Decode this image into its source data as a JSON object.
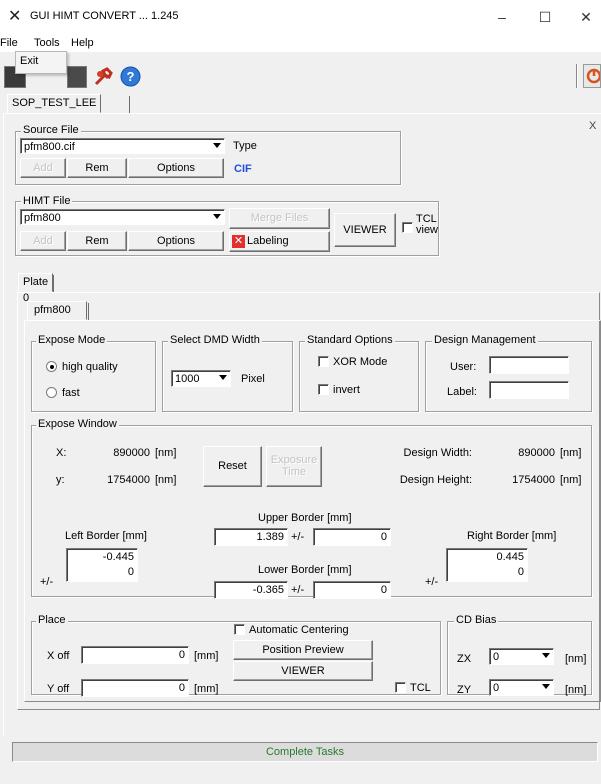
{
  "window": {
    "title": "GUI HIMT CONVERT ... 1.245",
    "minimize": "–",
    "maximize": "☐",
    "close": "✕"
  },
  "menu": {
    "file": "File",
    "tools": "Tools",
    "help": "Help",
    "exit": "Exit"
  },
  "workspace_tab": "SOP_TEST_LEE",
  "close_panel": "X",
  "source": {
    "group": "Source File",
    "file_value": "pfm800.cif",
    "add": "Add",
    "rem": "Rem",
    "options": "Options",
    "type_label": "Type",
    "type_value": "CIF"
  },
  "himt": {
    "group": "HIMT File",
    "file_value": "pfm800",
    "add": "Add",
    "rem": "Rem",
    "options": "Options",
    "merge": "Merge Files",
    "labeling": "Labeling",
    "viewer": "VIEWER",
    "tcl_line1": "TCL",
    "tcl_line2": "view"
  },
  "plate_tab": "Plate 0",
  "design_tab": "pfm800",
  "expose_mode": {
    "group": "Expose Mode",
    "high": "high quality",
    "fast": "fast",
    "selected": "high quality"
  },
  "dmd": {
    "group": "Select DMD Width",
    "value": "1000",
    "unit": "Pixel"
  },
  "standard": {
    "group": "Standard Options",
    "xor": "XOR Mode",
    "invert": "invert"
  },
  "design_mgmt": {
    "group": "Design Management",
    "user": "User:",
    "label": "Label:",
    "user_value": "",
    "label_value": ""
  },
  "expose_window": {
    "group": "Expose Window",
    "x_label": "X:",
    "x_value": "890000",
    "x_unit": "[nm]",
    "y_label": "y:",
    "y_value": "1754000",
    "y_unit": "[nm]",
    "reset": "Reset",
    "exposure_line1": "Exposure",
    "exposure_line2": "Time",
    "dw_label": "Design Width:",
    "dw_value": "890000",
    "dw_unit": "[nm]",
    "dh_label": "Design Height:",
    "dh_value": "1754000",
    "dh_unit": "[nm]",
    "left_label": "Left Border [mm]",
    "left_value": "-0.445",
    "left_pm_value": "0",
    "left_pm": "+/-",
    "upper_label": "Upper Border [mm]",
    "upper_value": "1.389",
    "upper_pm_value": "0",
    "upper_pm": "+/-",
    "lower_label": "Lower Border [mm]",
    "lower_value": "-0.365",
    "lower_pm_value": "0",
    "lower_pm": "+/-",
    "right_label": "Right Border [mm]",
    "right_value": "0.445",
    "right_pm_value": "0",
    "right_pm": "+/-"
  },
  "place": {
    "group": "Place",
    "xoff_label": "X off",
    "xoff_value": "0",
    "xoff_unit": "[mm]",
    "yoff_label": "Y off",
    "yoff_value": "0",
    "yoff_unit": "[mm]",
    "auto_center": "Automatic Centering",
    "preview": "Position Preview",
    "viewer": "VIEWER",
    "tcl": "TCL"
  },
  "cd_bias": {
    "group": "CD Bias",
    "zx": "ZX",
    "zx_value": "0",
    "zx_unit": "[nm]",
    "zy": "ZY",
    "zy_value": "0",
    "zy_unit": "[nm]"
  },
  "status": {
    "text": "Complete Tasks"
  },
  "colors": {
    "accent": "#2a7a2a",
    "cif": "#1f4fd8",
    "error": "#e03030"
  }
}
